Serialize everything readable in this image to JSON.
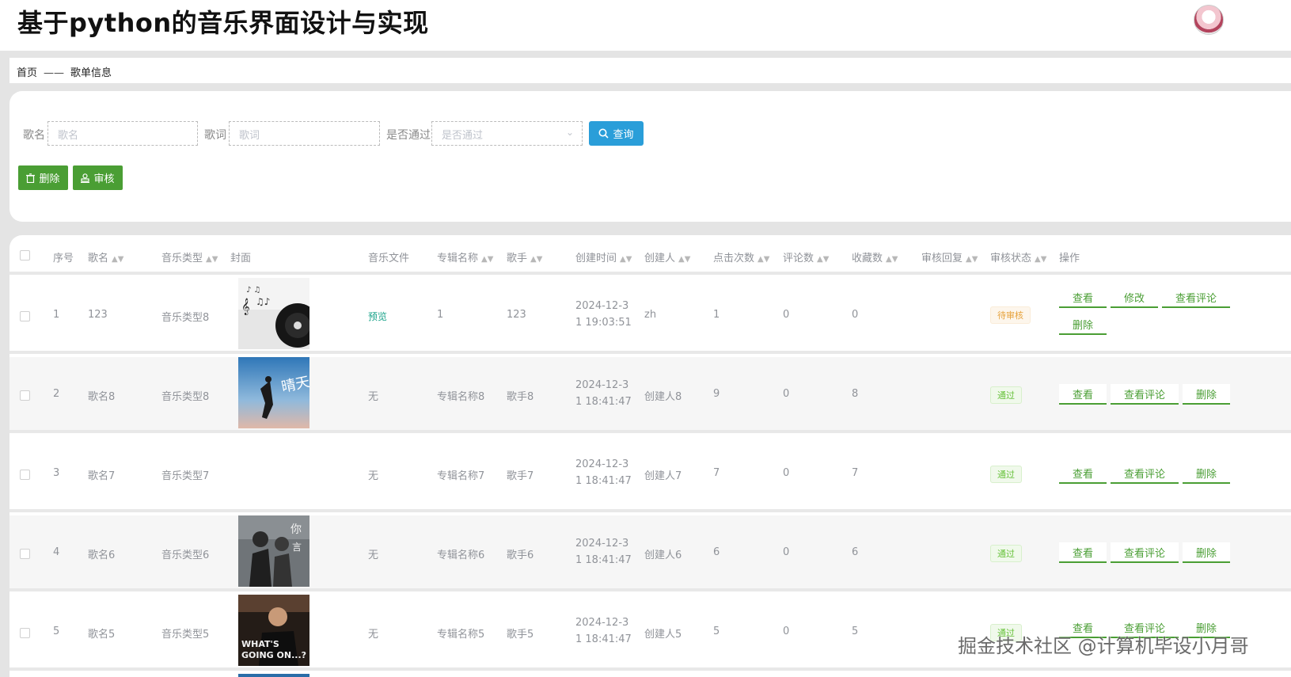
{
  "app": {
    "title": "基于python的音乐界面设计与实现"
  },
  "breadcrumb": {
    "home": "首页",
    "separator": "——",
    "current": "歌单信息"
  },
  "search": {
    "song_label": "歌名",
    "song_placeholder": "歌名",
    "lyrics_label": "歌词",
    "lyrics_placeholder": "歌词",
    "passed_label": "是否通过",
    "passed_placeholder": "是否通过",
    "query_button": "查询",
    "delete_button": "删除",
    "review_button": "审核"
  },
  "table": {
    "headers": [
      "序号",
      "歌名",
      "音乐类型",
      "封面",
      "音乐文件",
      "专辑名称",
      "歌手",
      "创建时间",
      "创建人",
      "点击次数",
      "评论数",
      "收藏数",
      "审核回复",
      "审核状态",
      "操作"
    ],
    "rows": [
      {
        "index": "1",
        "name": "123",
        "type": "音乐类型8",
        "file": "预览",
        "album": "1",
        "singer": "123",
        "time_line1": "2024-12-3",
        "time_line2": "1 19:03:51",
        "creator": "zh",
        "clicks": "1",
        "comments": "0",
        "favorites": "0",
        "status": "待审核",
        "ops": [
          "查看",
          "修改",
          "查看评论",
          "删除"
        ]
      },
      {
        "index": "2",
        "name": "歌名8",
        "type": "音乐类型8",
        "file": "无",
        "album": "专辑名称8",
        "singer": "歌手8",
        "time_line1": "2024-12-3",
        "time_line2": "1 18:41:47",
        "creator": "创建人8",
        "clicks": "9",
        "comments": "0",
        "favorites": "8",
        "status": "通过",
        "ops": [
          "查看",
          "查看评论",
          "删除"
        ]
      },
      {
        "index": "3",
        "name": "歌名7",
        "type": "音乐类型7",
        "file": "无",
        "album": "专辑名称7",
        "singer": "歌手7",
        "time_line1": "2024-12-3",
        "time_line2": "1 18:41:47",
        "creator": "创建人7",
        "clicks": "7",
        "comments": "0",
        "favorites": "7",
        "status": "通过",
        "ops": [
          "查看",
          "查看评论",
          "删除"
        ]
      },
      {
        "index": "4",
        "name": "歌名6",
        "type": "音乐类型6",
        "file": "无",
        "album": "专辑名称6",
        "singer": "歌手6",
        "time_line1": "2024-12-3",
        "time_line2": "1 18:41:47",
        "creator": "创建人6",
        "clicks": "6",
        "comments": "0",
        "favorites": "6",
        "status": "通过",
        "ops": [
          "查看",
          "查看评论",
          "删除"
        ]
      },
      {
        "index": "5",
        "name": "歌名5",
        "type": "音乐类型5",
        "file": "无",
        "album": "专辑名称5",
        "singer": "歌手5",
        "time_line1": "2024-12-3",
        "time_line2": "1 18:41:47",
        "creator": "创建人5",
        "clicks": "5",
        "comments": "0",
        "favorites": "5",
        "status": "通过",
        "ops": [
          "查看",
          "查看评论",
          "删除"
        ]
      }
    ]
  },
  "watermark": "掘金技术社区 @计算机毕设小月哥",
  "colors": {
    "primary_blue": "#2a9ed9",
    "action_green": "#4a9e34",
    "pass_tag": "#67c23a",
    "pending_tag": "#e6a23c"
  }
}
